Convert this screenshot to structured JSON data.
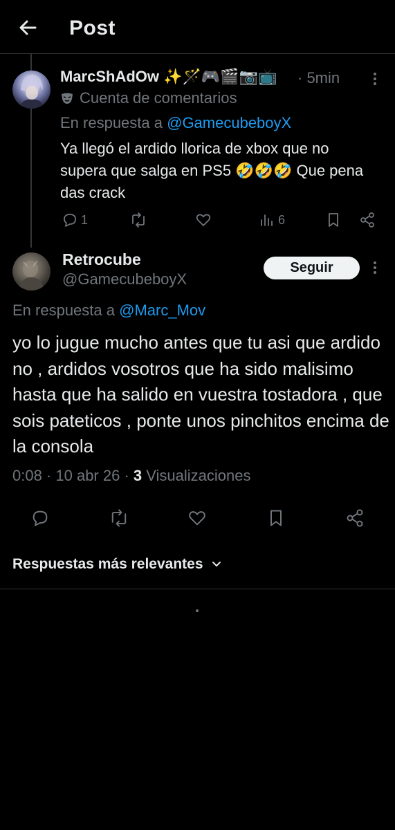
{
  "header": {
    "title": "Post",
    "back_icon": "arrow-left-icon"
  },
  "parent_reply": {
    "display_name": "MarcShAdOw ✨🪄🎮🎬📷📺",
    "time": "· 5min",
    "automated_label": "Cuenta de comentarios",
    "replying_prefix": "En respuesta a ",
    "replying_to": "@GamecubeboyX",
    "text": "Ya llegó el ardido llorica de xbox que no supera que salga en PS5 🤣🤣🤣 Que pena das crack",
    "reply_count": "1",
    "view_count": "6"
  },
  "main_post": {
    "display_name": "Retrocube",
    "handle": "@GamecubeboyX",
    "follow_label": "Seguir",
    "replying_prefix": "En respuesta a ",
    "replying_to": "@Marc_Mov",
    "text": "yo lo jugue mucho antes que tu asi que ardido no , ardidos vosotros que ha sido malisimo hasta que ha salido en vuestra tostadora , que sois pateticos , ponte unos pinchitos encima de la consola",
    "timestamp": "0:08 · 10 abr 26 · ",
    "views_count": "3",
    "views_label": " Visualizaciones"
  },
  "sort": {
    "label": "Respuestas más relevantes"
  },
  "colors": {
    "background": "#000000",
    "text": "#e7e9ea",
    "muted": "#71767b",
    "link": "#1d9bf0",
    "divider": "#2f3336"
  }
}
